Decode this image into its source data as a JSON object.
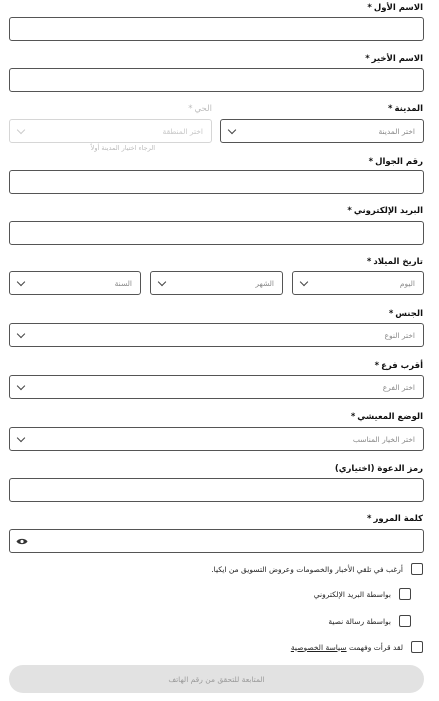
{
  "form": {
    "first_name": {
      "label": "الاسم الأول",
      "required": "*"
    },
    "last_name": {
      "label": "الاسم الأخير",
      "required": "*"
    },
    "city": {
      "label": "المدينة",
      "required": "*",
      "placeholder": "اختر المدينة"
    },
    "district": {
      "label": "الحي",
      "required": "*",
      "placeholder": "اختر المنطقة",
      "hint": "الرجاء اختيار المدينة أولاً"
    },
    "mobile": {
      "label": "رقم الجوال",
      "required": "*"
    },
    "email": {
      "label": "البريد الإلكتروني",
      "required": "*"
    },
    "birthdate": {
      "label": "تاريخ الميلاد",
      "required": "*",
      "day": "اليوم",
      "month": "الشهر",
      "year": "السنة"
    },
    "gender": {
      "label": "الجنس",
      "required": "*",
      "placeholder": "اختر النوع"
    },
    "branch": {
      "label": "أقرب فرع",
      "required": "*",
      "placeholder": "اختر الفرع"
    },
    "living": {
      "label": "الوضع المعيشي",
      "required": "*",
      "placeholder": "اختر الخيار المناسب"
    },
    "invite": {
      "label": "رمز الدعوة (اختياري)"
    },
    "password": {
      "label": "كلمة المرور",
      "required": "*"
    },
    "news_opt": {
      "label": "أرغب في تلقي الأخبار والخصومات وعروض التسويق من ايكيا."
    },
    "by_email": {
      "label": "بواسطة البريد الإلكتروني"
    },
    "by_sms": {
      "label": "بواسطة رسالة نصية"
    },
    "privacy": {
      "prefix": "لقد قرأت وفهمت",
      "link": "سياسة الخصوصية"
    },
    "submit_label": "المتابعة للتحقق من رقم الهاتف"
  }
}
